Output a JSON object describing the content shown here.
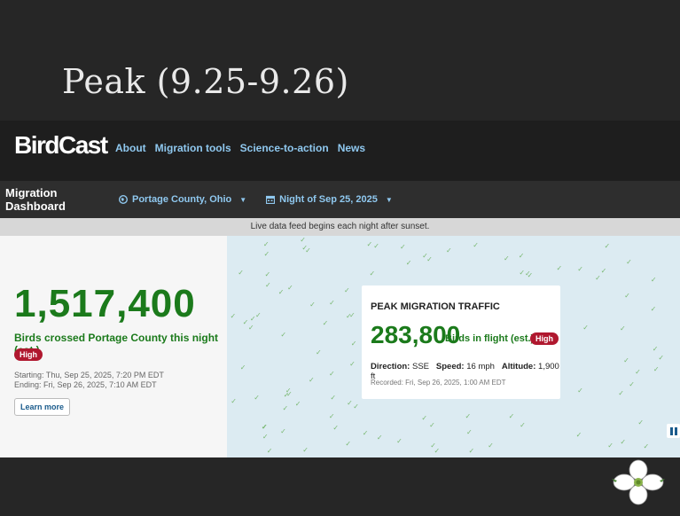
{
  "slide": {
    "title": "Peak (9.25-9.26)"
  },
  "nav": {
    "logo": "BirdCast",
    "links": [
      "About",
      "Migration tools",
      "Science-to-action",
      "News"
    ]
  },
  "dashboard": {
    "title": "Migration Dashboard",
    "location": "Portage County, Ohio",
    "night": "Night of Sep 25, 2025",
    "feed_notice": "Live data feed begins each night after sunset."
  },
  "summary": {
    "total": "1,517,400",
    "label": "Birds crossed Portage County this night (est.)",
    "badge": "High",
    "starting": "Starting: Thu, Sep 25, 2025, 7:20 PM EDT",
    "ending": "Ending: Fri, Sep 26, 2025, 7:10 AM EDT",
    "learn_more": "Learn more"
  },
  "peak": {
    "title": "PEAK MIGRATION TRAFFIC",
    "value": "283,800",
    "value_label": "Birds in flight (est.)",
    "badge": "High",
    "direction_label": "Direction:",
    "direction": "SSE",
    "speed_label": "Speed:",
    "speed": "16 mph",
    "altitude_label": "Altitude:",
    "altitude": "1,900 ft",
    "recorded": "Recorded: Fri, Sep 26, 2025, 1:00 AM EDT"
  },
  "colors": {
    "accent_link": "#8fc8ef",
    "count_green": "#1b7a1b",
    "badge_red": "#b0182f",
    "map_bg": "#dcebf2"
  }
}
